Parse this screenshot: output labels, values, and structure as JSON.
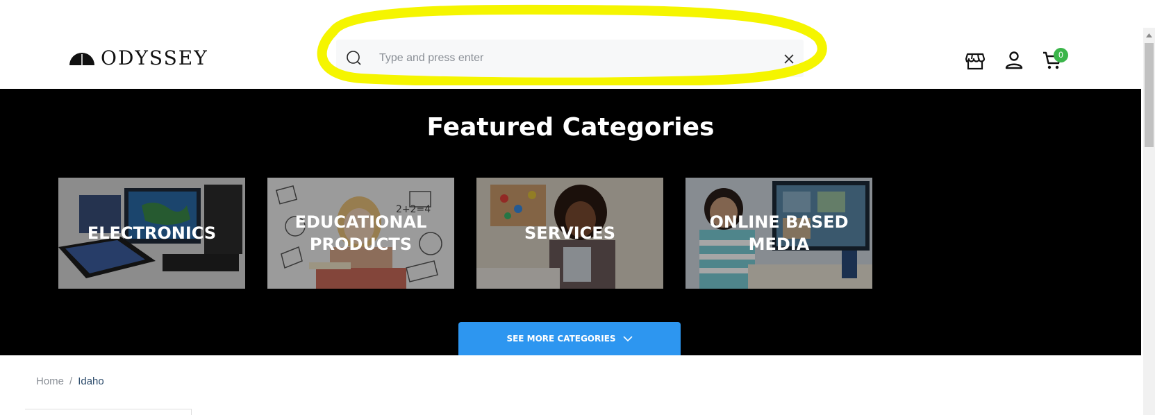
{
  "header": {
    "logo_text": "ODYSSEY",
    "search": {
      "placeholder": "Type and press enter",
      "value": ""
    },
    "cart_count": "0"
  },
  "featured": {
    "title": "Featured Categories",
    "categories": [
      {
        "label_line1": "ELECTRONICS",
        "label_line2": ""
      },
      {
        "label_line1": "EDUCATIONAL",
        "label_line2": "PRODUCTS"
      },
      {
        "label_line1": "SERVICES",
        "label_line2": ""
      },
      {
        "label_line1": "ONLINE BASED",
        "label_line2": "MEDIA"
      }
    ],
    "see_more_label": "SEE MORE CATEGORIES"
  },
  "breadcrumb": {
    "home": "Home",
    "separator": "/",
    "current": "Idaho"
  },
  "colors": {
    "band_background": "#000000",
    "button_blue": "#2d96f0",
    "cart_badge_green": "#3bb54a",
    "highlight_yellow": "#f5f500"
  },
  "icons": {
    "search": "search-icon",
    "clear": "close-icon",
    "store": "store-icon",
    "account": "user-icon",
    "cart": "cart-icon",
    "chevron": "chevron-down-icon"
  }
}
